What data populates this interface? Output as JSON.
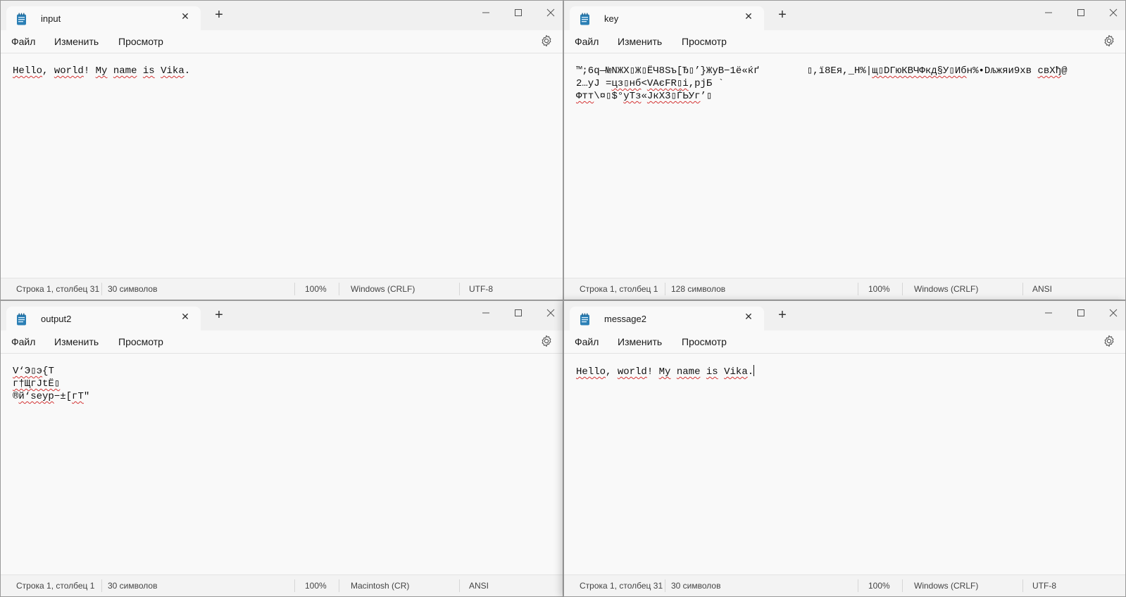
{
  "menu": [
    "Файл",
    "Изменить",
    "Просмотр"
  ],
  "windows": [
    {
      "tab_title": "input",
      "lines": [
        [
          {
            "t": "Hello",
            "s": true
          },
          {
            "t": ", "
          },
          {
            "t": "world",
            "s": true
          },
          {
            "t": "! "
          },
          {
            "t": "My",
            "s": true
          },
          {
            "t": " "
          },
          {
            "t": "name",
            "s": true
          },
          {
            "t": " "
          },
          {
            "t": "is",
            "s": true
          },
          {
            "t": " "
          },
          {
            "t": "Vika",
            "s": true
          },
          {
            "t": "."
          }
        ]
      ],
      "caret": false,
      "status": {
        "position": "Строка 1, столбец 31",
        "chars": "30 символов",
        "zoom": "100%",
        "line_ending": "Windows (CRLF)",
        "encoding": "UTF-8"
      }
    },
    {
      "tab_title": "key",
      "lines": [
        [
          {
            "t": "™;6q—№NЖХ▯Ж▯ЁЧ8Sъ[Ђ▯’}ЖуВ−1ё«ќґ        ▯,ї8Ея,_H%|"
          },
          {
            "t": "щ▯DГюКВЧФкд§У▯Иб",
            "s": true
          },
          {
            "t": "н%•Dљжяи9хв "
          },
          {
            "t": "свХђ",
            "s": true
          },
          {
            "t": "@"
          }
        ],
        [
          {
            "t": "2…уЈ ="
          },
          {
            "t": "цз▯нб",
            "s": true
          },
          {
            "t": "<"
          },
          {
            "t": "VAєFR▯i",
            "s": true
          },
          {
            "t": ",рјБ `"
          }
        ],
        [
          {
            "t": "Фтт",
            "s": true
          },
          {
            "t": "\\¤▯$°"
          },
          {
            "t": "уТз",
            "s": true
          },
          {
            "t": "«"
          },
          {
            "t": "JкХ3▯ЃЬУг",
            "s": true
          },
          {
            "t": "’▯"
          }
        ]
      ],
      "caret": false,
      "status": {
        "position": "Строка 1, столбец 1",
        "chars": "128 символов",
        "zoom": "100%",
        "line_ending": "Windows (CRLF)",
        "encoding": "ANSI"
      }
    },
    {
      "tab_title": "output2",
      "lines": [
        [
          {
            "t": "V‘Э▯э",
            "s": true
          },
          {
            "t": "{Т"
          }
        ],
        [
          {
            "t": "г†ЩгЈtЁ▯",
            "s": true
          }
        ],
        [
          {
            "t": "®"
          },
          {
            "t": "й‘seур",
            "s": true
          },
          {
            "t": "−±["
          },
          {
            "t": "гТ",
            "s": true
          },
          {
            "t": "\""
          }
        ]
      ],
      "caret": false,
      "status": {
        "position": "Строка 1, столбец 1",
        "chars": "30 символов",
        "zoom": "100%",
        "line_ending": "Macintosh (CR)",
        "encoding": "ANSI"
      }
    },
    {
      "tab_title": "message2",
      "lines": [
        [
          {
            "t": "Hello",
            "s": true
          },
          {
            "t": ", "
          },
          {
            "t": "world",
            "s": true
          },
          {
            "t": "! "
          },
          {
            "t": "My",
            "s": true
          },
          {
            "t": " "
          },
          {
            "t": "name",
            "s": true
          },
          {
            "t": " "
          },
          {
            "t": "is",
            "s": true
          },
          {
            "t": " "
          },
          {
            "t": "Vika",
            "s": true
          },
          {
            "t": "."
          }
        ]
      ],
      "caret": true,
      "status": {
        "position": "Строка 1, столбец 31",
        "chars": "30 символов",
        "zoom": "100%",
        "line_ending": "Windows (CRLF)",
        "encoding": "UTF-8"
      }
    }
  ],
  "icons": {
    "app": "notepad-icon",
    "close": "close-icon",
    "new_tab": "plus-icon",
    "minimize": "minimize-icon",
    "maximize": "maximize-icon",
    "window_close": "window-close-icon",
    "settings": "gear-icon"
  },
  "colors": {
    "spell_underline": "#d43333",
    "app_icon": "#2b7fb5"
  }
}
